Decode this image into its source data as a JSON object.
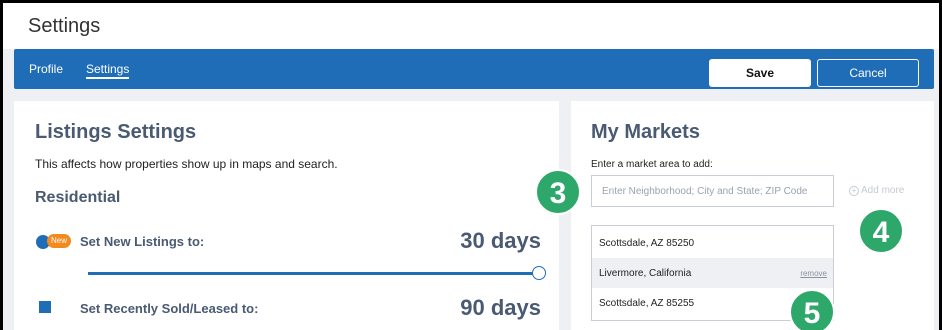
{
  "window": {
    "title": "Settings"
  },
  "nav": {
    "tabs": [
      {
        "label": "Profile"
      },
      {
        "label": "Settings"
      }
    ],
    "save_label": "Save",
    "cancel_label": "Cancel"
  },
  "listings": {
    "title": "Listings Settings",
    "description": "This affects how properties show up in maps and search.",
    "section": "Residential",
    "new_listings": {
      "badge": "New",
      "label": "Set New Listings to:",
      "value": "30 days",
      "slider_fraction": 1.0
    },
    "recently_sold": {
      "label": "Set Recently Sold/Leased to:",
      "value": "90 days"
    }
  },
  "markets": {
    "title": "My Markets",
    "input_label": "Enter a market area to add:",
    "input_placeholder": "Enter Neighborhood; City and State; ZIP Code",
    "add_more_label": "Add more",
    "items": [
      {
        "name": "Scottsdale, AZ 85250"
      },
      {
        "name": "Livermore, California",
        "remove_label": "remove"
      },
      {
        "name": "Scottsdale, AZ 85255"
      }
    ]
  },
  "steps": {
    "three": "3",
    "four": "4",
    "five": "5"
  },
  "colors": {
    "brand_blue": "#1f6db7",
    "step_green": "#2ea86a",
    "badge_orange": "#f28a1d"
  }
}
